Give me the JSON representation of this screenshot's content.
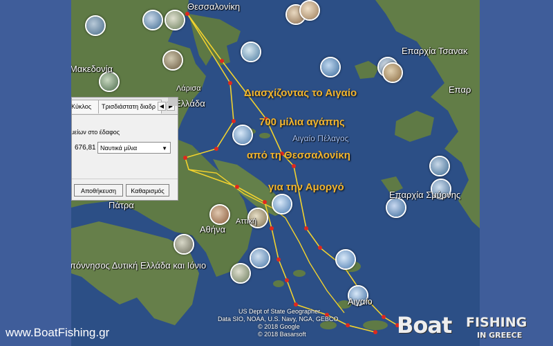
{
  "map": {
    "place_labels": {
      "thessaloniki": "Θεσσαλονίκη",
      "makedonia": "Μακεδονία",
      "larisa": "Λάρισα",
      "ellada": "Ελλάδα",
      "patra": "Πάτρα",
      "athina": "Αθήνα",
      "attiki": "Αττική",
      "peloponnisos": "πόννησος Δυτική Ελλάδα και Ιόνιο",
      "aigaio_pelagos": "Αιγαίο Πέλαγος",
      "aigaio": "Αιγαίο",
      "eparchia_tsanak": "Επαρχία Τσανακ",
      "epar": "Επαρ",
      "eparchia_smyrnis": "Επαρχία Σμύρνης"
    },
    "overlay_text": {
      "line1": "Διασχίζοντας το Αιγαίο",
      "line2": "700 μίλια αγάπης",
      "line3": "από τη Θεσσαλονίκη",
      "line4": "για την Αμοργό"
    },
    "attribution": {
      "line1": "US Dept of State Geographer",
      "line2": "Data SIO, NOAA, U.S. Navy, NGA, GEBCO",
      "line3": "© 2018 Google",
      "line4": "© 2018 Basarsoft"
    },
    "route_color": "#f2d22e",
    "waypoint_color": "#e0281d",
    "sea_color": "#2c4f86",
    "land_color": "#5f7a45"
  },
  "panel": {
    "tab_circle": "Κύκλος",
    "tab_3d": "Τρισδιάστατη διαδρ",
    "ground_text": "μείων στο έδαφος",
    "distance_value": "676,81",
    "unit_selected": "Ναυτικά μίλια",
    "save_label": "Αποθήκευση",
    "clear_label": "Καθαρισμός"
  },
  "footer": {
    "website": "www.BoatFishing.gr",
    "brand_boat": "Boat",
    "brand_fishing": "FISHING",
    "brand_ingreece": "IN GREECE"
  }
}
